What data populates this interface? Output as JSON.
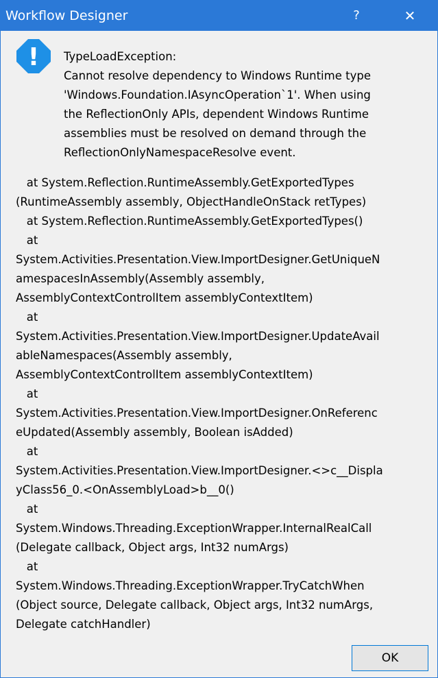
{
  "window": {
    "title": "Workflow Designer",
    "help_glyph": "?",
    "close_glyph": "✕"
  },
  "icon": {
    "name": "exclamation-icon",
    "color": "#1e90e6",
    "glyph": "!"
  },
  "message": {
    "lines": [
      "TypeLoadException:",
      "Cannot resolve dependency to Windows Runtime type",
      "'Windows.Foundation.IAsyncOperation`1'. When using",
      "the ReflectionOnly APIs, dependent Windows Runtime",
      "assemblies must be resolved on demand through the",
      "ReflectionOnlyNamespaceResolve event."
    ]
  },
  "stack_trace": {
    "lines": [
      "   at System.Reflection.RuntimeAssembly.GetExportedTypes",
      "(RuntimeAssembly assembly, ObjectHandleOnStack retTypes)",
      "   at System.Reflection.RuntimeAssembly.GetExportedTypes()",
      "   at",
      "System.Activities.Presentation.View.ImportDesigner.GetUniqueN",
      "amespacesInAssembly(Assembly assembly,",
      "AssemblyContextControlItem assemblyContextItem)",
      "   at",
      "System.Activities.Presentation.View.ImportDesigner.UpdateAvail",
      "ableNamespaces(Assembly assembly,",
      "AssemblyContextControlItem assemblyContextItem)",
      "   at",
      "System.Activities.Presentation.View.ImportDesigner.OnReferenc",
      "eUpdated(Assembly assembly, Boolean isAdded)",
      "   at",
      "System.Activities.Presentation.View.ImportDesigner.<>c__Displa",
      "yClass56_0.<OnAssemblyLoad>b__0()",
      "   at",
      "System.Windows.Threading.ExceptionWrapper.InternalRealCall",
      "(Delegate callback, Object args, Int32 numArgs)",
      "   at",
      "System.Windows.Threading.ExceptionWrapper.TryCatchWhen",
      "(Object source, Delegate callback, Object args, Int32 numArgs,",
      "Delegate catchHandler)"
    ]
  },
  "buttons": {
    "ok_label": "OK"
  }
}
